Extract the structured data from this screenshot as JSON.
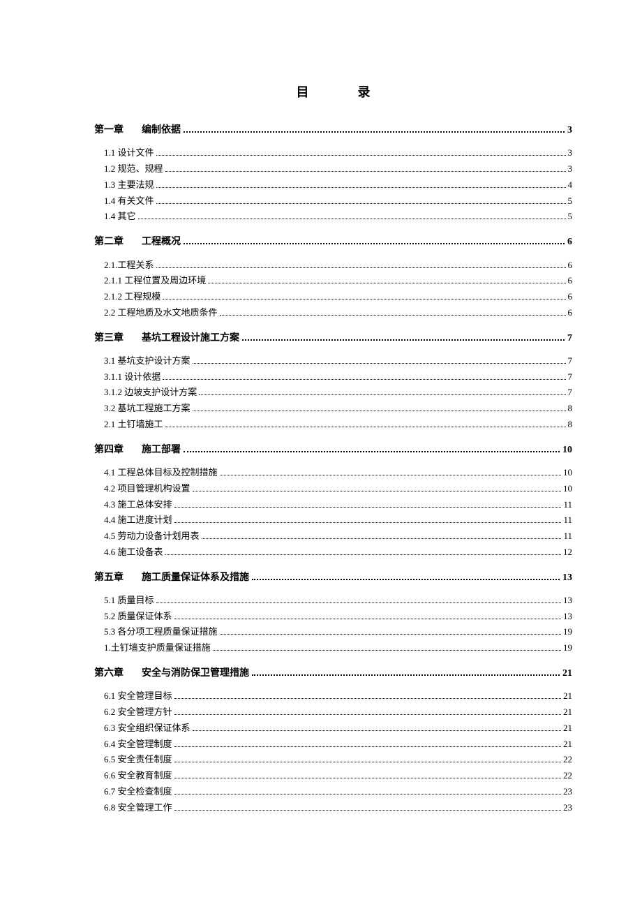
{
  "title_left": "目",
  "title_right": "录",
  "chapters": [
    {
      "label": "第一章",
      "title": "编制依据",
      "page": "3",
      "subs": [
        {
          "text": "1.1 设计文件",
          "page": "3"
        },
        {
          "text": "1.2 规范、规程",
          "page": "3"
        },
        {
          "text": "1.3 主要法规",
          "page": "4"
        },
        {
          "text": "1.4 有关文件",
          "page": "5"
        },
        {
          "text": "1.4 其它",
          "page": "5"
        }
      ]
    },
    {
      "label": "第二章",
      "title": "工程概况",
      "page": "6",
      "subs": [
        {
          "text": "2.1.工程关系",
          "page": "6"
        },
        {
          "text": "2.1.1 工程位置及周边环境",
          "page": "6"
        },
        {
          "text": "2.1.2 工程规模",
          "page": "6"
        },
        {
          "text": "2.2 工程地质及水文地质条件",
          "page": "6"
        }
      ]
    },
    {
      "label": "第三章",
      "title": "基坑工程设计施工方案",
      "page": "7",
      "subs": [
        {
          "text": "3.1 基坑支护设计方案",
          "page": "7"
        },
        {
          "text": "3.1.1 设计依据",
          "page": "7"
        },
        {
          "text": "3.1.2 边坡支护设计方案",
          "page": "7"
        },
        {
          "text": "3.2 基坑工程施工方案",
          "page": "8"
        },
        {
          "text": "2.1 土钉墙施工",
          "page": "8"
        }
      ]
    },
    {
      "label": "第四章",
      "title": "施工部署",
      "page": "10",
      "subs": [
        {
          "text": "4.1 工程总体目标及控制措施",
          "page": "10"
        },
        {
          "text": "4.2 项目管理机构设置",
          "page": "10"
        },
        {
          "text": "4.3 施工总体安排",
          "page": "11"
        },
        {
          "text": "4.4 施工进度计划",
          "page": "11"
        },
        {
          "text": "4.5 劳动力设备计划用表",
          "page": "11"
        },
        {
          "text": "4.6 施工设备表",
          "page": "12"
        }
      ]
    },
    {
      "label": "第五章",
      "title": "施工质量保证体系及措施",
      "page": "13",
      "subs": [
        {
          "text": "5.1 质量目标",
          "page": "13"
        },
        {
          "text": "5.2 质量保证体系",
          "page": "13"
        },
        {
          "text": "5.3 各分项工程质量保证措施",
          "page": "19"
        },
        {
          "text": "1.土钉墙支护质量保证措施",
          "page": "19"
        }
      ]
    },
    {
      "label": "第六章",
      "title": "安全与消防保卫管理措施",
      "page": "21",
      "subs": [
        {
          "text": "6.1 安全管理目标",
          "page": "21"
        },
        {
          "text": "6.2 安全管理方针",
          "page": "21"
        },
        {
          "text": "6.3 安全组织保证体系",
          "page": "21"
        },
        {
          "text": "6.4 安全管理制度",
          "page": "21"
        },
        {
          "text": "6.5 安全责任制度",
          "page": "22"
        },
        {
          "text": "6.6 安全教育制度",
          "page": "22"
        },
        {
          "text": "6.7 安全检查制度",
          "page": "23"
        },
        {
          "text": "6.8 安全管理工作",
          "page": "23"
        }
      ]
    }
  ]
}
